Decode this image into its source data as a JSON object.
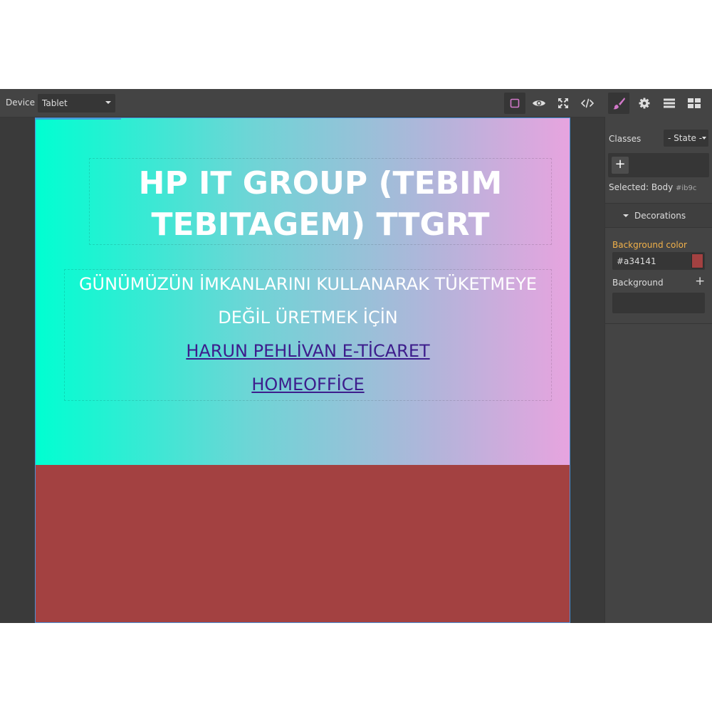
{
  "toolbar": {
    "device_label": "Device",
    "device_value": "Tablet",
    "buttons": [
      {
        "icon": "square-outline-icon",
        "active": true
      },
      {
        "icon": "eye-icon"
      },
      {
        "icon": "fullscreen-icon"
      },
      {
        "icon": "code-icon"
      }
    ]
  },
  "panel_tabs": [
    {
      "icon": "paint-brush-icon",
      "active": true
    },
    {
      "icon": "gear-icon"
    },
    {
      "icon": "layers-icon"
    },
    {
      "icon": "blocks-icon"
    }
  ],
  "canvas": {
    "title": "HP IT GROUP (TEBIM TEBITAGEM) TTGRT",
    "subtitle_line1": "GÜNÜMÜZÜN İMKANLARINI KULLANARAK TÜKETMEYE",
    "subtitle_line2": "DEĞİL ÜRETMEK İÇİN",
    "link1": "HARUN PEHLİVAN E-TİCARET",
    "link2": "HOMEOFFİCE",
    "colors": {
      "link": "#3d1d8c",
      "body_background": "#a34141",
      "gradient_start": "#00ffd1",
      "gradient_end": "#e7a4df"
    }
  },
  "panel": {
    "classes_label": "Classes",
    "state_value": "- State -",
    "add_class": "+",
    "selected_label": "Selected:",
    "selected_name": "Body",
    "selected_id": "#ib9c",
    "sector_title": "Decorations",
    "bg_color_label": "Background color",
    "bg_color_value": "#a34141",
    "background_label": "Background",
    "background_add": "+"
  }
}
